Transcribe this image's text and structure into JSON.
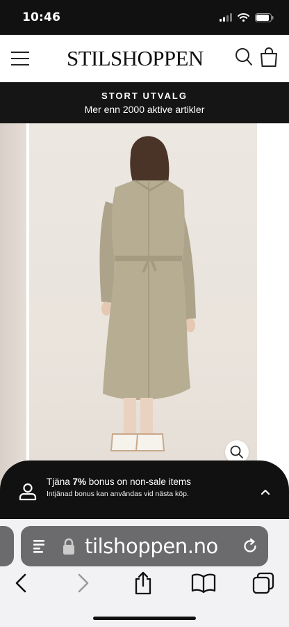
{
  "status_bar": {
    "time": "10:46"
  },
  "header": {
    "logo": "STILSHOPPEN"
  },
  "promo": {
    "title": "STORT UTVALG",
    "subtitle": "Mer enn 2000 aktive artikler"
  },
  "bonus": {
    "prefix": "Tjäna ",
    "percent": "7%",
    "suffix": " bonus on non-sale items",
    "subtitle": "Intjänad bonus kan användas vid nästa köp."
  },
  "browser": {
    "url": "tilshoppen.no"
  },
  "icons": {
    "menu": "hamburger-menu-icon",
    "search": "search-icon",
    "cart": "shopping-bag-icon",
    "zoom": "magnifier-icon",
    "user": "user-icon",
    "expand": "chevron-up-icon",
    "reader": "reader-icon",
    "lock": "lock-icon",
    "reload": "reload-icon",
    "back": "back-icon",
    "forward": "forward-icon",
    "share": "share-icon",
    "bookmarks": "bookmarks-icon",
    "tabs": "tabs-icon"
  }
}
